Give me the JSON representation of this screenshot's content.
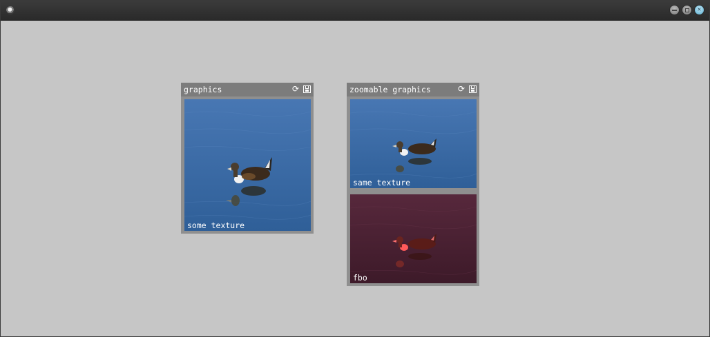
{
  "window": {
    "title": ""
  },
  "panels": [
    {
      "title": "graphics",
      "tiles": [
        {
          "label": "some texture",
          "tint": "blue"
        }
      ]
    },
    {
      "title": "zoomable graphics",
      "tiles": [
        {
          "label": "same texture",
          "tint": "blue"
        },
        {
          "label": "fbo",
          "tint": "red"
        }
      ]
    }
  ],
  "icons": {
    "refresh": "refresh-icon",
    "save": "save-icon",
    "app": "app-icon"
  },
  "colors": {
    "background": "#c6c6c6",
    "panel_frame": "#8f8f8f",
    "panel_header": "#7c7c7c",
    "water_blue": "#3a6aa5",
    "fbo_tint": "#4a2233"
  }
}
